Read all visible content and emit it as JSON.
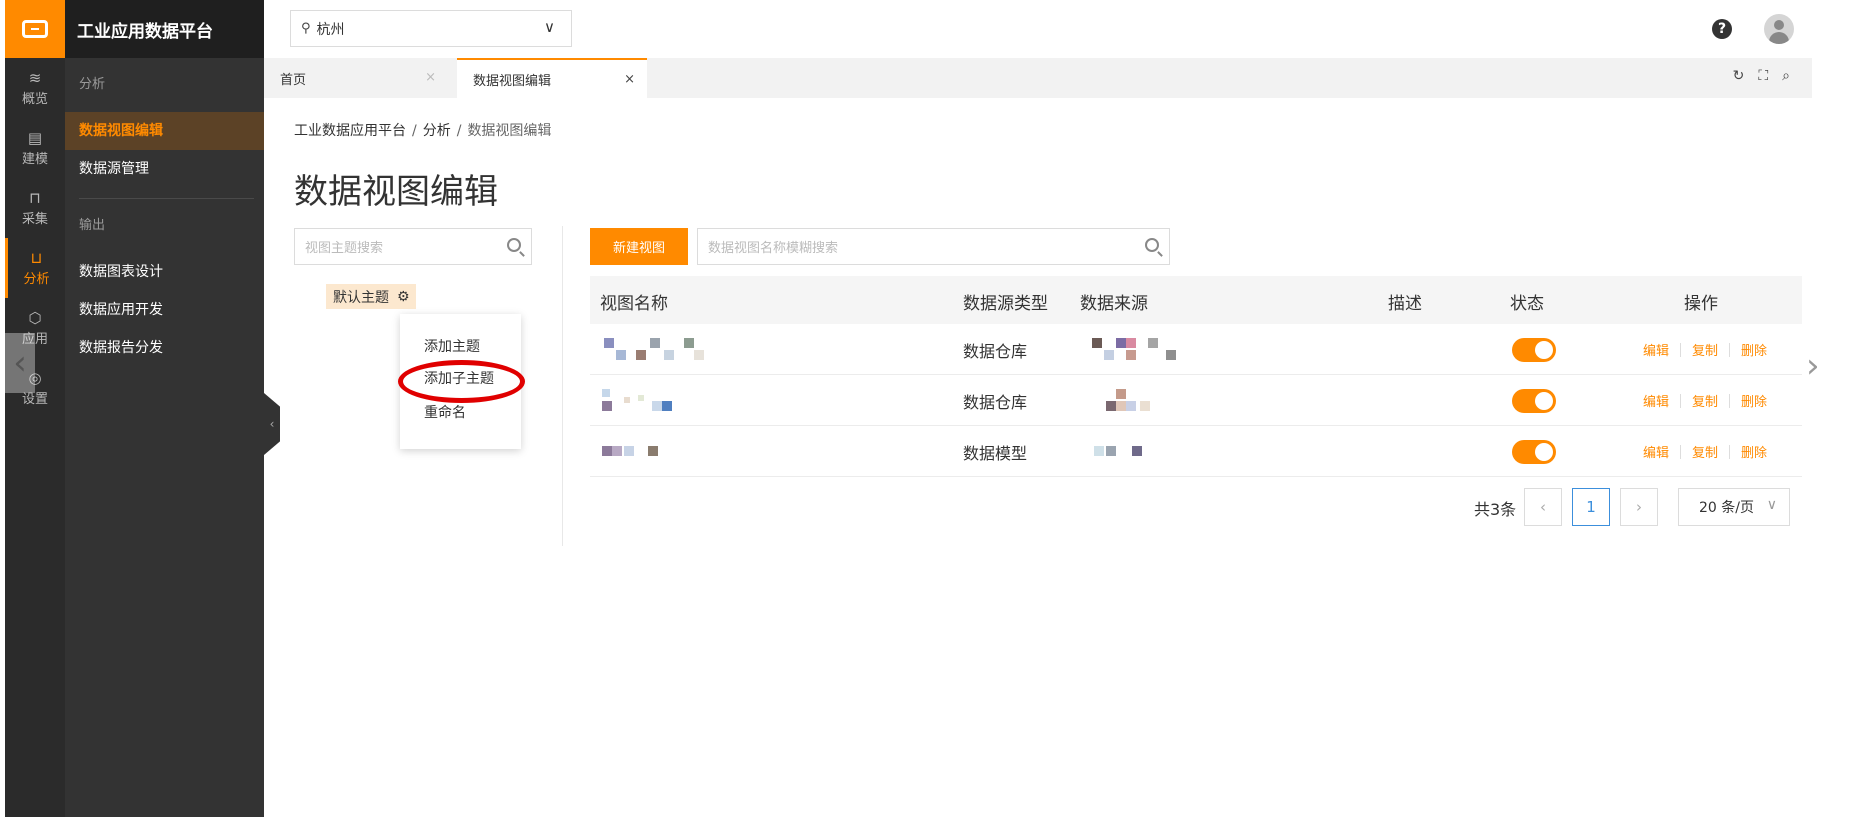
{
  "app": {
    "title": "工业应用数据平台"
  },
  "rail": {
    "items": [
      {
        "icon": "stack-icon",
        "glyph": "≋",
        "label": "概览"
      },
      {
        "icon": "model-icon",
        "glyph": "▤",
        "label": "建模"
      },
      {
        "icon": "collect-icon",
        "glyph": "⊓",
        "label": "采集"
      },
      {
        "icon": "chart-icon",
        "glyph": "⊔",
        "label": "分析"
      },
      {
        "icon": "cube-icon",
        "glyph": "⬡",
        "label": "应用"
      },
      {
        "icon": "settings-icon",
        "glyph": "◎",
        "label": "设置"
      }
    ]
  },
  "menu": {
    "group1": "分析",
    "items1": [
      "数据视图编辑",
      "数据源管理"
    ],
    "group2": "输出",
    "items2": [
      "数据图表设计",
      "数据应用开发",
      "数据报告分发"
    ]
  },
  "topbar": {
    "city": "杭州"
  },
  "tabs": {
    "home": "首页",
    "active": "数据视图编辑"
  },
  "breadcrumb": {
    "root": "工业数据应用平台",
    "level1": "分析",
    "current": "数据视图编辑"
  },
  "page": {
    "title": "数据视图编辑"
  },
  "theme": {
    "search_placeholder": "视图主题搜索",
    "default_theme": "默认主题",
    "context_menu": [
      "添加主题",
      "添加子主题",
      "重命名"
    ]
  },
  "toolbar": {
    "new_view": "新建视图",
    "search_placeholder": "数据视图名称模糊搜索"
  },
  "table": {
    "headers": {
      "name": "视图名称",
      "source_type": "数据源类型",
      "source": "数据来源",
      "desc": "描述",
      "status": "状态",
      "ops": "操作"
    },
    "rows": [
      {
        "source_type": "数据仓库",
        "status_on": true
      },
      {
        "source_type": "数据仓库",
        "status_on": true
      },
      {
        "source_type": "数据模型",
        "status_on": true
      }
    ],
    "ops": {
      "edit": "编辑",
      "copy": "复制",
      "delete": "删除"
    }
  },
  "pagination": {
    "total": "共3条",
    "current_page": "1",
    "page_size": "20 条/页"
  },
  "colors": {
    "accent": "#ff8a00",
    "sidebar": "#333333",
    "highlight_ring": "#e00000"
  }
}
